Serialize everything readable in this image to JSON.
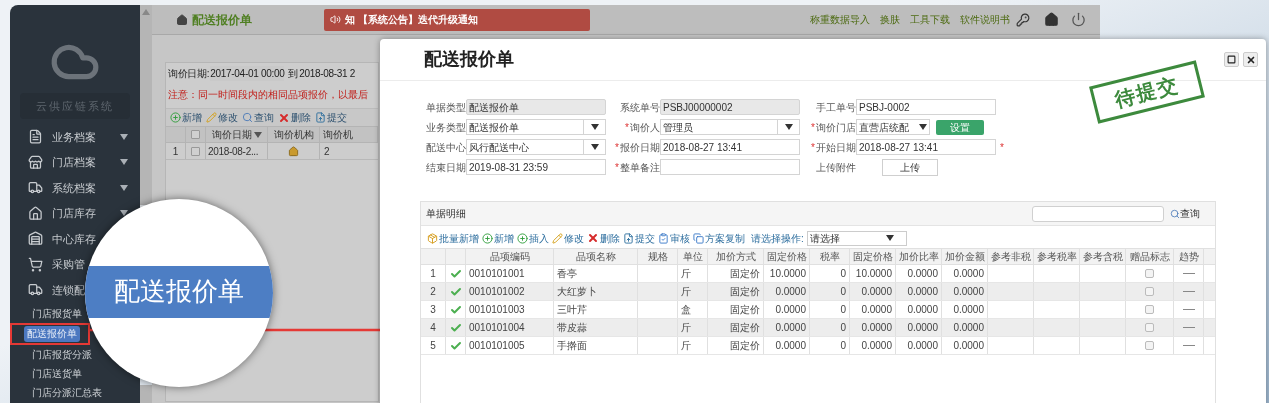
{
  "sidebar": {
    "system_name": "云供应链系统",
    "menu": [
      {
        "label": "业务档案",
        "has_caret": true
      },
      {
        "label": "门店档案",
        "has_caret": true
      },
      {
        "label": "系统档案",
        "has_caret": true
      },
      {
        "label": "门店库存",
        "has_caret": true
      },
      {
        "label": "中心库存",
        "has_caret": false
      },
      {
        "label": "采购管",
        "has_caret": false
      },
      {
        "label": "连锁配",
        "has_caret": false
      }
    ],
    "submenu": [
      {
        "label": "门店报货单",
        "selected": false
      },
      {
        "label": "配送报价单",
        "selected": true
      },
      {
        "label": "门店报货分派",
        "selected": false
      },
      {
        "label": "门店送货单",
        "selected": false
      },
      {
        "label": "门店分派汇总表",
        "selected": false
      }
    ]
  },
  "header": {
    "page_title": "配送报价单",
    "notice": "知 【系统公告】迭代升级通知",
    "links": [
      "称重数据导入",
      "换肤",
      "工具下载",
      "软件说明书"
    ]
  },
  "filter": {
    "label": "询价日期:",
    "from": "2017-04-01 00:00",
    "to_label": "到",
    "to": "2018-08-31 2"
  },
  "warning": "注意：同一时间段内的相同品项报价，以最后",
  "toolbar": [
    {
      "kind": "add",
      "label": "新增"
    },
    {
      "kind": "edit",
      "label": "修改"
    },
    {
      "kind": "search",
      "label": "查询"
    },
    {
      "kind": "delete",
      "label": "删除"
    },
    {
      "kind": "submit",
      "label": "提交"
    }
  ],
  "list_table": {
    "select_all": false,
    "columns": [
      "询价日期",
      "询价机构",
      "询价机"
    ],
    "rows": [
      {
        "no": "1",
        "checked": false,
        "date": "2018-08-2...",
        "count": "2"
      }
    ]
  },
  "magnifier": {
    "text": "配送报价单"
  },
  "dialog": {
    "title": "配送报价单",
    "stamp": "待提交",
    "fields": [
      {
        "kind": "readonly",
        "label": "单据类型",
        "required": false,
        "value": "配送报价单"
      },
      {
        "kind": "readonly",
        "label": "系统单号",
        "required": false,
        "value": "PSBJ00000002"
      },
      {
        "kind": "text",
        "label": "手工单号",
        "required": false,
        "value": "PSBJ-0002"
      },
      {
        "kind": "select",
        "label": "业务类型",
        "required": false,
        "value": "配送报价单"
      },
      {
        "kind": "select",
        "label": "询价人",
        "required": true,
        "value": "管理员"
      },
      {
        "kind": "select_button",
        "label": "询价门店",
        "required": true,
        "value": "直营店统配",
        "button": "设置"
      },
      {
        "kind": "select",
        "label": "配送中心",
        "required": false,
        "value": "风行配送中心"
      },
      {
        "kind": "text",
        "label": "报价日期",
        "required": true,
        "value": "2018-08-27 13:41"
      },
      {
        "kind": "text",
        "label": "开始日期",
        "required": true,
        "value": "2018-08-27 13:41",
        "after": "*"
      },
      {
        "kind": "text",
        "label": "结束日期",
        "required": false,
        "value": "2019-08-31 23:59"
      },
      {
        "kind": "text",
        "label": "整单备注",
        "required": true
      },
      {
        "kind": "button",
        "label": "上传附件",
        "required": false,
        "button": "上传"
      }
    ],
    "detail": {
      "title": "单据明细",
      "search_button": "查询",
      "toolbar": [
        {
          "kind": "batch_add",
          "label": "批量新增"
        },
        {
          "kind": "add",
          "label": "新增"
        },
        {
          "kind": "insert",
          "label": "插入"
        },
        {
          "kind": "edit",
          "label": "修改"
        },
        {
          "kind": "delete",
          "label": "删除"
        },
        {
          "kind": "submit",
          "label": "提交"
        },
        {
          "kind": "audit",
          "label": "审核"
        },
        {
          "kind": "copy",
          "label": "方案复制"
        }
      ],
      "operation_label": "请选择操作:",
      "operation_value": "请选择",
      "columns": [
        "品项编码",
        "品项名称",
        "规格",
        "单位",
        "加价方式",
        "固定价格",
        "税率",
        "固定价格",
        "加价比率",
        "加价金额",
        "参考非税",
        "参考税率",
        "参考含税",
        "赠品标志",
        "趋势"
      ],
      "rows": [
        {
          "no": "1",
          "verified": true,
          "code": "0010101001",
          "name": "香亭",
          "unit": "斤",
          "method": "固定价",
          "price": "10.0000",
          "tax": "0",
          "fixed": "10.0000",
          "ratio": "0.0000",
          "amount": "0.0000",
          "gift": false
        },
        {
          "no": "2",
          "verified": true,
          "code": "0010101002",
          "name": "大红萝卜",
          "unit": "斤",
          "method": "固定价",
          "price": "0.0000",
          "tax": "0",
          "fixed": "0.0000",
          "ratio": "0.0000",
          "amount": "0.0000",
          "gift": false
        },
        {
          "no": "3",
          "verified": true,
          "code": "0010101003",
          "name": "三叶芹",
          "unit": "盒",
          "method": "固定价",
          "price": "0.0000",
          "tax": "0",
          "fixed": "0.0000",
          "ratio": "0.0000",
          "amount": "0.0000",
          "gift": false
        },
        {
          "no": "4",
          "verified": true,
          "code": "0010101004",
          "name": "带皮蒜",
          "unit": "斤",
          "method": "固定价",
          "price": "0.0000",
          "tax": "0",
          "fixed": "0.0000",
          "ratio": "0.0000",
          "amount": "0.0000",
          "gift": false
        },
        {
          "no": "5",
          "verified": true,
          "code": "0010101005",
          "name": "手擀面",
          "unit": "斤",
          "method": "固定价",
          "price": "0.0000",
          "tax": "0",
          "fixed": "0.0000",
          "ratio": "0.0000",
          "amount": "0.0000",
          "gift": false
        }
      ]
    }
  }
}
